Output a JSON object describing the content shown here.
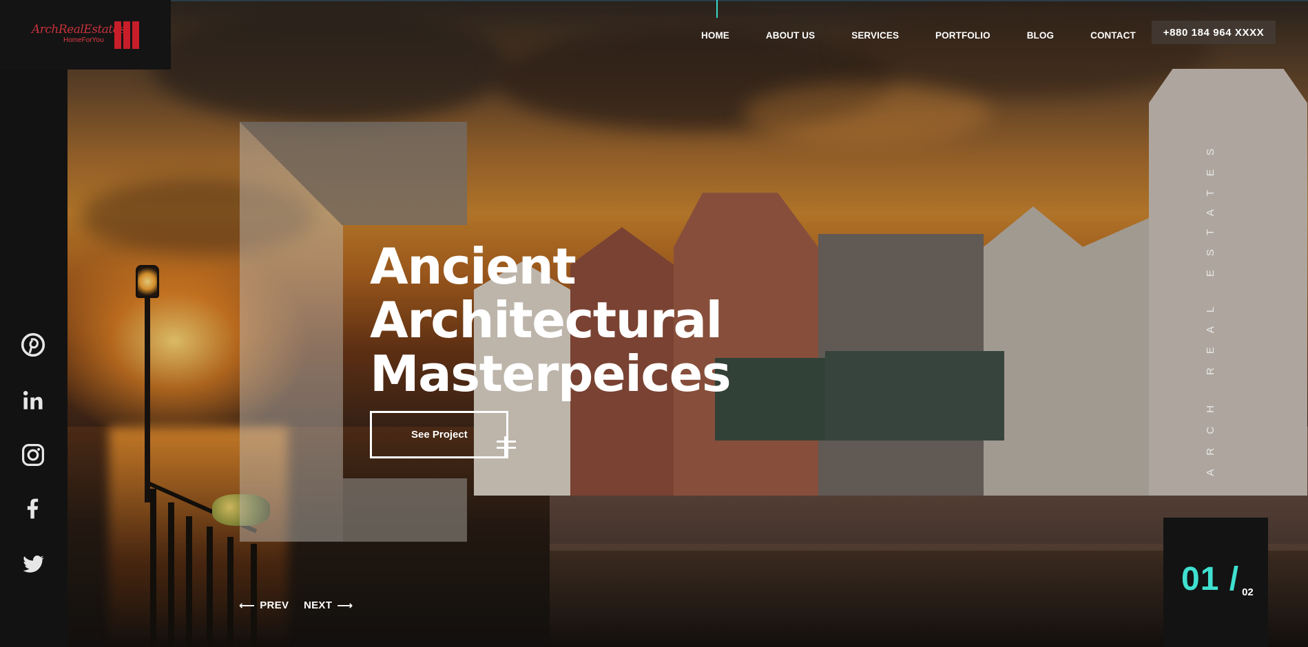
{
  "brand": {
    "logo_main": "ArchRealEstates",
    "logo_tagline": "HomeForYou",
    "accent_color": "#3fe0cf",
    "logo_color": "#c81e2a"
  },
  "nav": {
    "items": [
      {
        "label": "HOME"
      },
      {
        "label": "ABOUT US"
      },
      {
        "label": "SERVICES"
      },
      {
        "label": "PORTFOLIO"
      },
      {
        "label": "BLOG"
      },
      {
        "label": "CONTACT"
      }
    ],
    "phone": "+880 184 964 XXXX"
  },
  "social": [
    {
      "icon": "pinterest-icon"
    },
    {
      "icon": "linkedin-icon"
    },
    {
      "icon": "instagram-icon"
    },
    {
      "icon": "facebook-icon"
    },
    {
      "icon": "twitter-icon"
    }
  ],
  "hero": {
    "headline_lines": [
      "Ancient",
      "Architectural",
      "Masterpeices"
    ],
    "cta_label": "See Project",
    "prev_label": "PREV",
    "next_label": "NEXT",
    "side_text": "ARCH REAL ESTATES"
  },
  "slider": {
    "current": "01 /",
    "total": "02"
  }
}
